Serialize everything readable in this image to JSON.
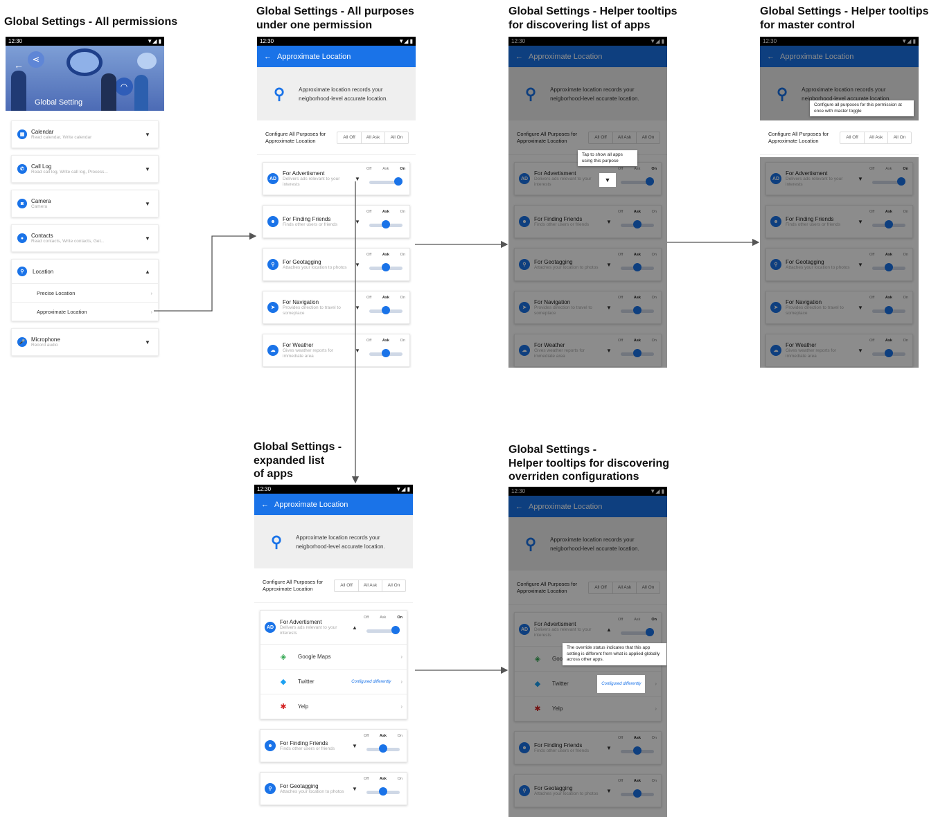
{
  "titles": {
    "t1": [
      "Global Settings - All permissions"
    ],
    "t2": [
      "Global Settings - All purposes",
      "under one permission"
    ],
    "t3": [
      "Global Settings - Helper tooltips",
      "for discovering list of apps"
    ],
    "t4": [
      "Global Settings - Helper tooltips",
      "for master control"
    ],
    "t5": [
      "Global Settings -",
      "expanded list",
      "of apps"
    ],
    "t6": [
      "Global Settings -",
      "Helper tooltips for discovering",
      "overriden configurations"
    ]
  },
  "status_time": "12:30",
  "status_icons": "▼◢ ▮",
  "hero_label": "Global Setting",
  "permissions": [
    {
      "name": "Calendar",
      "desc": "Read calendar, Write calendar",
      "icon": "calendar-icon",
      "glyph": "▦"
    },
    {
      "name": "Call Log",
      "desc": "Read call log, Write call log, Process...",
      "icon": "phone-icon",
      "glyph": "✆"
    },
    {
      "name": "Camera",
      "desc": "Camera",
      "icon": "camera-icon",
      "glyph": "◙"
    },
    {
      "name": "Contacts",
      "desc": "Read contacts, Write contacts, Get...",
      "icon": "person-icon",
      "glyph": "●"
    },
    {
      "name": "Location",
      "desc": "",
      "icon": "location-pin-icon",
      "glyph": "⚲"
    },
    {
      "name": "Microphone",
      "desc": "Record audio",
      "icon": "microphone-icon",
      "glyph": "🎤"
    }
  ],
  "location_sub": [
    "Precise Location",
    "Approximate Location"
  ],
  "detail": {
    "appbar_title": "Approximate Location",
    "info_text": "Approximate location records your neigborhood-level accurate location.",
    "config_label": "Configure All Purposes for Approximate Location",
    "seg": [
      "All Off",
      "All Ask",
      "All On"
    ],
    "tri_labels": [
      "Off",
      "Ask",
      "On"
    ]
  },
  "purposes": [
    {
      "name": "For Advertisment",
      "desc": "Delivers ads relevant to your interests",
      "icon": "ad-icon",
      "glyph": "AD",
      "state": "On"
    },
    {
      "name": "For Finding Friends",
      "desc": "Finds other users or friends",
      "icon": "people-icon",
      "glyph": "☻",
      "state": "Ask"
    },
    {
      "name": "For Geotagging",
      "desc": "Attaches your location to photos",
      "icon": "location-pin-icon",
      "glyph": "⚲",
      "state": "Ask"
    },
    {
      "name": "For Navigation",
      "desc": "Provides direction to travel to someplace",
      "icon": "navigation-icon",
      "glyph": "➤",
      "state": "Ask"
    },
    {
      "name": "For Weather",
      "desc": "Gives weather reports for immediate area",
      "icon": "cloud-icon",
      "glyph": "☁",
      "state": "Ask"
    }
  ],
  "apps": [
    {
      "name": "Google Maps",
      "icon": "google-maps-icon",
      "glyph": "◈",
      "color": "#34a853",
      "note": ""
    },
    {
      "name": "Twitter",
      "icon": "twitter-icon",
      "glyph": "◆",
      "color": "#1da1f2",
      "note": "Configured differently"
    },
    {
      "name": "Yelp",
      "icon": "yelp-icon",
      "glyph": "✱",
      "color": "#d32323",
      "note": ""
    }
  ],
  "tooltips": {
    "apps": "Tap to show all apps using this purpose",
    "master": "Configure all purposes for this permission at once with master toggle",
    "override": "The override status indicates that this app setting is different from what is applied globally across other apps."
  },
  "colors": {
    "primary": "#1a73e8",
    "overlay": "rgba(0,0,0,0.45)"
  }
}
